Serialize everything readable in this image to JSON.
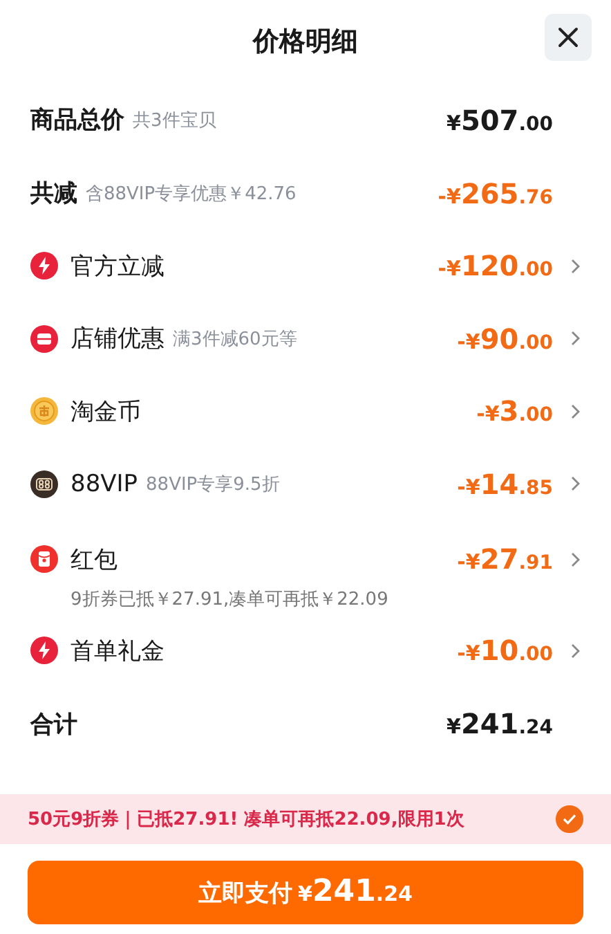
{
  "title": "价格明细",
  "summary": [
    {
      "label": "商品总价",
      "note": "共3件宝贝",
      "price": "¥507.00",
      "discount": false
    },
    {
      "label": "共减",
      "note": "含88VIP专享优惠￥42.76",
      "price": "-¥265.76",
      "discount": true
    }
  ],
  "items": [
    {
      "kind": "bolt",
      "label": "官方立减",
      "price": "-¥120.00"
    },
    {
      "kind": "shop",
      "label": "店铺优惠",
      "note": "满3件减60元等",
      "price": "-¥90.00"
    },
    {
      "kind": "coin",
      "label": "淘金币",
      "price": "-¥3.00"
    },
    {
      "kind": "vip",
      "label": "88VIP",
      "note": "88VIP专享9.5折",
      "price": "-¥14.85"
    },
    {
      "kind": "packet",
      "label": "红包",
      "price": "-¥27.91",
      "detail": "9折券已抵￥27.91,凑单可再抵￥22.09"
    },
    {
      "kind": "bolt",
      "label": "首单礼金",
      "price": "-¥10.00"
    }
  ],
  "total": {
    "label": "合计",
    "price": "¥241.24"
  },
  "coupon": {
    "text": "50元9折券｜已抵27.91! 凑单可再抵22.09,限用1次",
    "checked": true
  },
  "pay_button": {
    "label": "立即支付",
    "price": "¥241.24"
  }
}
